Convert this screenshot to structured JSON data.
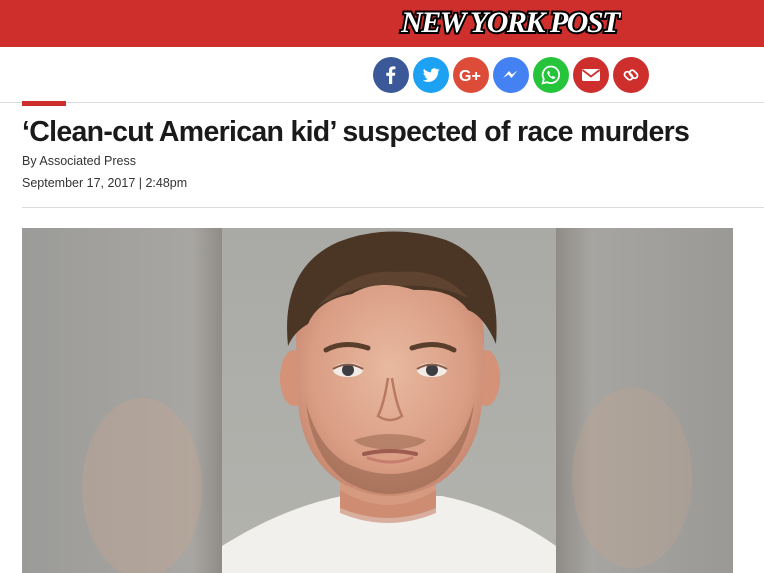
{
  "header": {
    "logo_text": "NEW YORK POST",
    "brand_color": "#cf2f2c"
  },
  "share": {
    "buttons": [
      {
        "icon": "facebook-icon",
        "color": "#3b5998"
      },
      {
        "icon": "twitter-icon",
        "color": "#1da1f2"
      },
      {
        "icon": "google-plus-icon",
        "color": "#dd4b39"
      },
      {
        "icon": "messenger-icon",
        "color": "#4481f2"
      },
      {
        "icon": "whatsapp-icon",
        "color": "#25c43a"
      },
      {
        "icon": "email-icon",
        "color": "#cf2f2c"
      },
      {
        "icon": "link-icon",
        "color": "#cf2f2c"
      }
    ]
  },
  "article": {
    "headline": "‘Clean-cut American kid’ suspected of race murders",
    "byline": "By Associated Press",
    "date": "September 17, 2017 | 2:48pm"
  },
  "photo": {
    "subject": "mugshot-photo"
  }
}
